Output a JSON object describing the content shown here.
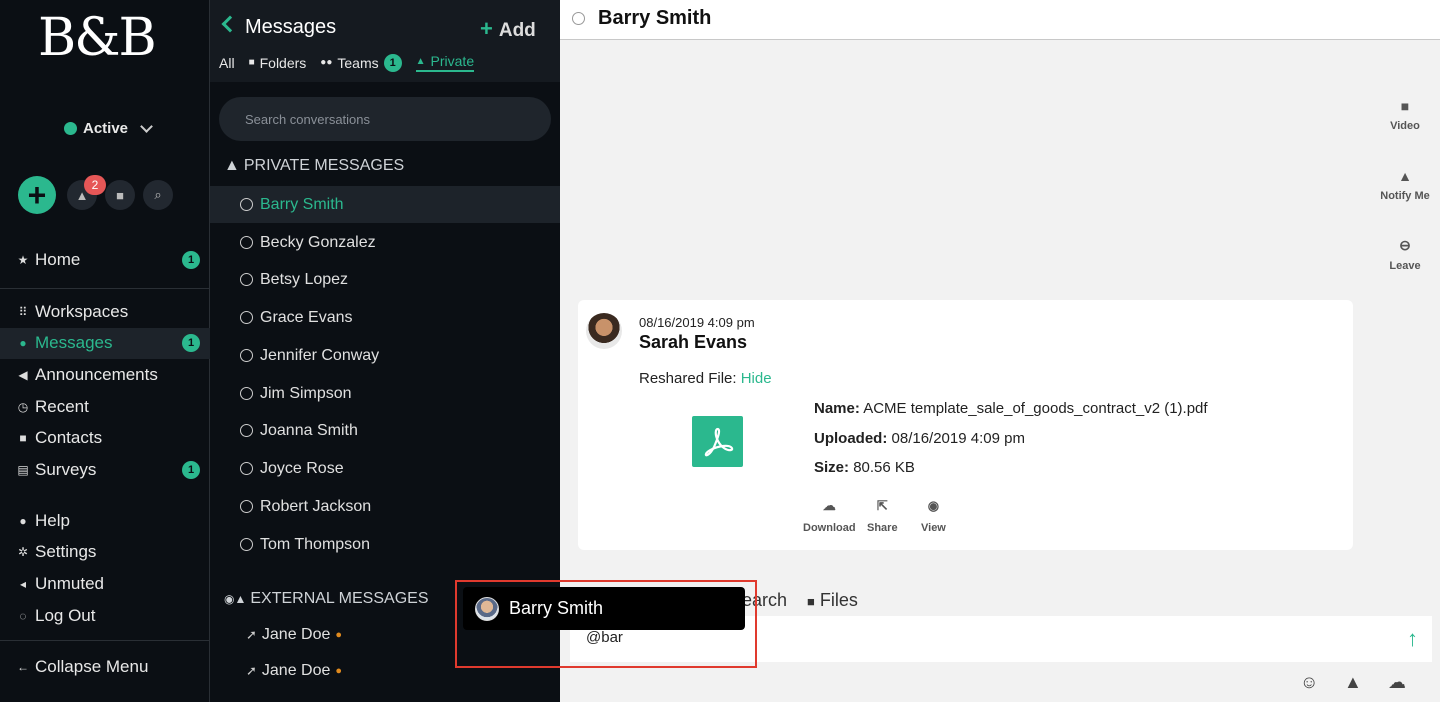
{
  "nav": {
    "logo": "B&B",
    "status": "Active",
    "alerts_count": "2",
    "items": [
      {
        "icon": "star-icon",
        "label": "Home",
        "badge": "1"
      },
      {
        "icon": "grid-icon",
        "label": "Workspaces",
        "badge": ""
      },
      {
        "icon": "chat-icon",
        "label": "Messages",
        "badge": "1"
      },
      {
        "icon": "megaphone-icon",
        "label": "Announcements",
        "badge": ""
      },
      {
        "icon": "history-icon",
        "label": "Recent",
        "badge": ""
      },
      {
        "icon": "contacts-icon",
        "label": "Contacts",
        "badge": ""
      },
      {
        "icon": "clipboard-icon",
        "label": "Surveys",
        "badge": "1"
      },
      {
        "icon": "info-icon",
        "label": "Help",
        "badge": ""
      },
      {
        "icon": "gear-icon",
        "label": "Settings",
        "badge": ""
      },
      {
        "icon": "speaker-icon",
        "label": "Unmuted",
        "badge": ""
      },
      {
        "icon": "logout-icon",
        "label": "Log Out",
        "badge": ""
      }
    ],
    "collapse": "Collapse Menu"
  },
  "conv": {
    "title": "Messages",
    "add": "Add",
    "filters": {
      "all": "All",
      "folders": "Folders",
      "teams": "Teams",
      "teams_badge": "1",
      "private": "Private"
    },
    "search_placeholder": "Search conversations",
    "private_heading": "PRIVATE MESSAGES",
    "private": [
      "Barry Smith",
      "Becky Gonzalez",
      "Betsy Lopez",
      "Grace Evans",
      "Jennifer Conway",
      "Jim Simpson",
      "Joanna Smith",
      "Joyce Rose",
      "Robert Jackson",
      "Tom Thompson"
    ],
    "external_heading": "EXTERNAL MESSAGES",
    "external": [
      "Jane Doe",
      "Jane Doe"
    ]
  },
  "main": {
    "title": "Barry Smith",
    "actions": {
      "video": "Video",
      "notify": "Notify Me",
      "leave": "Leave"
    },
    "message": {
      "date": "08/16/2019 4:09 pm",
      "author": "Sarah Evans",
      "reshared_label": "Reshared File:",
      "hide": "Hide",
      "name_label": "Name:",
      "name": "ACME template_sale_of_goods_contract_v2 (1).pdf",
      "uploaded_label": "Uploaded:",
      "uploaded": "08/16/2019 4:09 pm",
      "size_label": "Size:",
      "size": "80.56 KB",
      "download": "Download",
      "share": "Share",
      "view": "View"
    },
    "tabs": {
      "search": "Search",
      "files": "Files"
    },
    "compose_text": "@bar"
  },
  "mention": {
    "name": "Barry Smith"
  },
  "colors": {
    "accent": "#2bb88e",
    "sidebar": "#0b0f14",
    "highlight": "#e03a2e"
  }
}
